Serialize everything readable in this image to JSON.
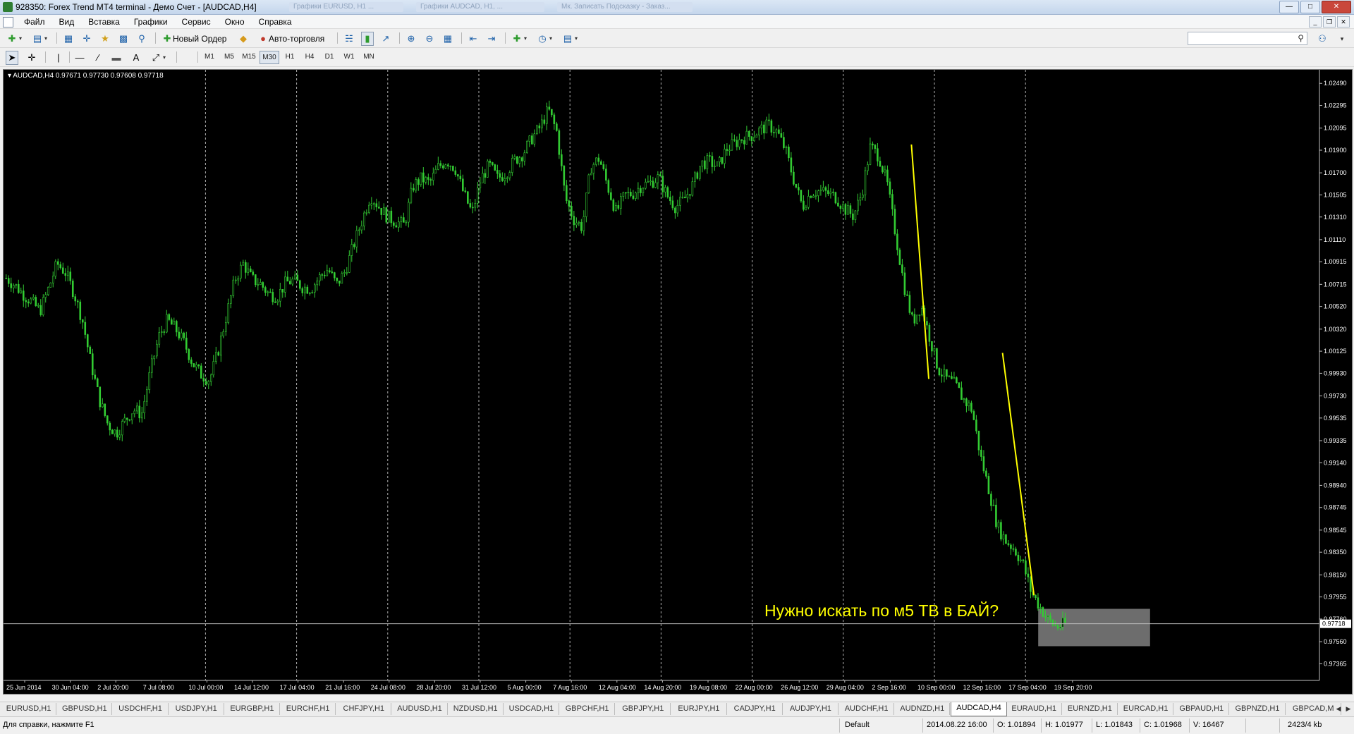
{
  "window": {
    "title": "928350: Forex Trend MT4 terminal - Демо Счет - [AUDCAD,H4]",
    "background_tabs": [
      "Графики EURUSD, H1 ...",
      "Графики AUDCAD, H1, ...",
      "Мк. Записать Подсказку - Заказ..."
    ]
  },
  "menu": {
    "items": [
      "Файл",
      "Вид",
      "Вставка",
      "Графики",
      "Сервис",
      "Окно",
      "Справка"
    ]
  },
  "toolbar": {
    "new_order_label": "Новый Ордер",
    "autotrading_label": "Авто-торговля",
    "search_placeholder": ""
  },
  "timeframes": [
    "M1",
    "M5",
    "M15",
    "M30",
    "H1",
    "H4",
    "D1",
    "W1",
    "MN"
  ],
  "active_timeframe": "M30",
  "chart": {
    "info": "AUDCAD,H4  0.97671 0.97730 0.97608 0.97718",
    "annotation": "Нужно искать по м5 ТВ в БАЙ?",
    "colors": {
      "background": "#000000",
      "candles": "#33cc33",
      "grid": "#cfcfcf",
      "trendline": "#ffff00",
      "zone": "#808080"
    }
  },
  "chart_data": {
    "type": "candlestick",
    "symbol": "AUDCAD",
    "timeframe": "H4",
    "title": "",
    "y_ticks": [
      1.0249,
      1.02295,
      1.02095,
      1.019,
      1.017,
      1.01505,
      1.0131,
      1.0111,
      1.00915,
      1.00715,
      1.0052,
      1.0032,
      1.00125,
      0.9993,
      0.9973,
      0.99535,
      0.99335,
      0.9914,
      0.9894,
      0.98745,
      0.98545,
      0.9835,
      0.9815,
      0.97955,
      0.9776,
      0.9756,
      0.97365
    ],
    "ylim": [
      0.973,
      1.026
    ],
    "current_price": 0.97718,
    "x_labels": [
      "25 Jun 2014",
      "30 Jun 04:00",
      "2 Jul 20:00",
      "7 Jul 08:00",
      "10 Jul 00:00",
      "14 Jul 12:00",
      "17 Jul 04:00",
      "21 Jul 16:00",
      "24 Jul 08:00",
      "28 Jul 20:00",
      "31 Jul 12:00",
      "5 Aug 00:00",
      "7 Aug 16:00",
      "12 Aug 04:00",
      "14 Aug 20:00",
      "19 Aug 08:00",
      "22 Aug 00:00",
      "26 Aug 12:00",
      "29 Aug 04:00",
      "2 Sep 16:00",
      "10 Sep 00:00",
      "12 Sep 16:00",
      "17 Sep 04:00",
      "19 Sep 20:00"
    ],
    "price_path": [
      1.0077,
      1.0071,
      1.0063,
      1.0056,
      1.0048,
      1.0068,
      1.009,
      1.0082,
      1.0064,
      1.004,
      1.0002,
      0.997,
      0.9948,
      0.994,
      0.9951,
      0.9961,
      0.9957,
      0.9994,
      1.0025,
      1.004,
      1.0032,
      1.002,
      1.0002,
      0.9992,
      0.9987,
      1.0012,
      1.0044,
      1.0076,
      1.009,
      1.0076,
      1.0072,
      1.0063,
      1.0061,
      1.0073,
      1.0075,
      1.0069,
      1.0068,
      1.0078,
      1.0085,
      1.0071,
      1.0083,
      1.0106,
      1.0128,
      1.015,
      1.014,
      1.0131,
      1.0127,
      1.0124,
      1.0158,
      1.0165,
      1.0161,
      1.0175,
      1.0181,
      1.0174,
      1.0152,
      1.0134,
      1.0164,
      1.0177,
      1.0165,
      1.017,
      1.0181,
      1.0187,
      1.02,
      1.021,
      1.0226,
      1.0206,
      1.0148,
      1.0129,
      1.0122,
      1.0175,
      1.0183,
      1.0158,
      1.0135,
      1.015,
      1.0152,
      1.0159,
      1.0161,
      1.0166,
      1.015,
      1.014,
      1.0146,
      1.0159,
      1.0178,
      1.018,
      1.0175,
      1.0191,
      1.0196,
      1.0201,
      1.0203,
      1.0208,
      1.0212,
      1.0206,
      1.019,
      1.0163,
      1.014,
      1.0153,
      1.0154,
      1.0152,
      1.0148,
      1.0138,
      1.0132,
      1.0152,
      1.0193,
      1.0185,
      1.016,
      1.0115,
      1.007,
      1.0038,
      1.0053,
      1.0025,
      0.9997,
      0.9988,
      0.9983,
      0.997,
      0.9961,
      0.992,
      0.989,
      0.9858,
      0.9845,
      0.9838,
      0.9825,
      0.98,
      0.9787,
      0.9775,
      0.9769,
      0.9772
    ],
    "trendlines": [
      {
        "from": [
          "2 Sep 16:00",
          1.0195
        ],
        "to": [
          "10 Sep 00:00",
          0.9988
        ]
      },
      {
        "from": [
          "12 Sep 16:00",
          1.0011
        ],
        "to": [
          "17 Sep 04:00",
          0.9797
        ]
      }
    ],
    "zone": {
      "from": "17 Sep 04:00",
      "to": "19 Sep 20:00",
      "y_top": 0.9785,
      "y_bottom": 0.9752
    }
  },
  "tabs": [
    "EURUSD,H1",
    "GBPUSD,H1",
    "USDCHF,H1",
    "USDJPY,H1",
    "EURGBP,H1",
    "EURCHF,H1",
    "CHFJPY,H1",
    "AUDUSD,H1",
    "NZDUSD,H1",
    "USDCAD,H1",
    "GBPCHF,H1",
    "GBPJPY,H1",
    "EURJPY,H1",
    "CADJPY,H1",
    "AUDJPY,H1",
    "AUDCHF,H1",
    "AUDNZD,H1",
    "AUDCAD,H4",
    "EURAUD,H1",
    "EURNZD,H1",
    "EURCAD,H1",
    "GBPAUD,H1",
    "GBPNZD,H1",
    "GBPCAD,M"
  ],
  "active_tab": "AUDCAD,H4",
  "status": {
    "help": "Для справки, нажмите F1",
    "profile": "Default",
    "datetime": "2014.08.22 16:00",
    "open": "O: 1.01894",
    "high": "H: 1.01977",
    "low": "L: 1.01843",
    "close": "C: 1.01968",
    "volume": "V: 16467",
    "traffic": "2423/4 kb"
  }
}
